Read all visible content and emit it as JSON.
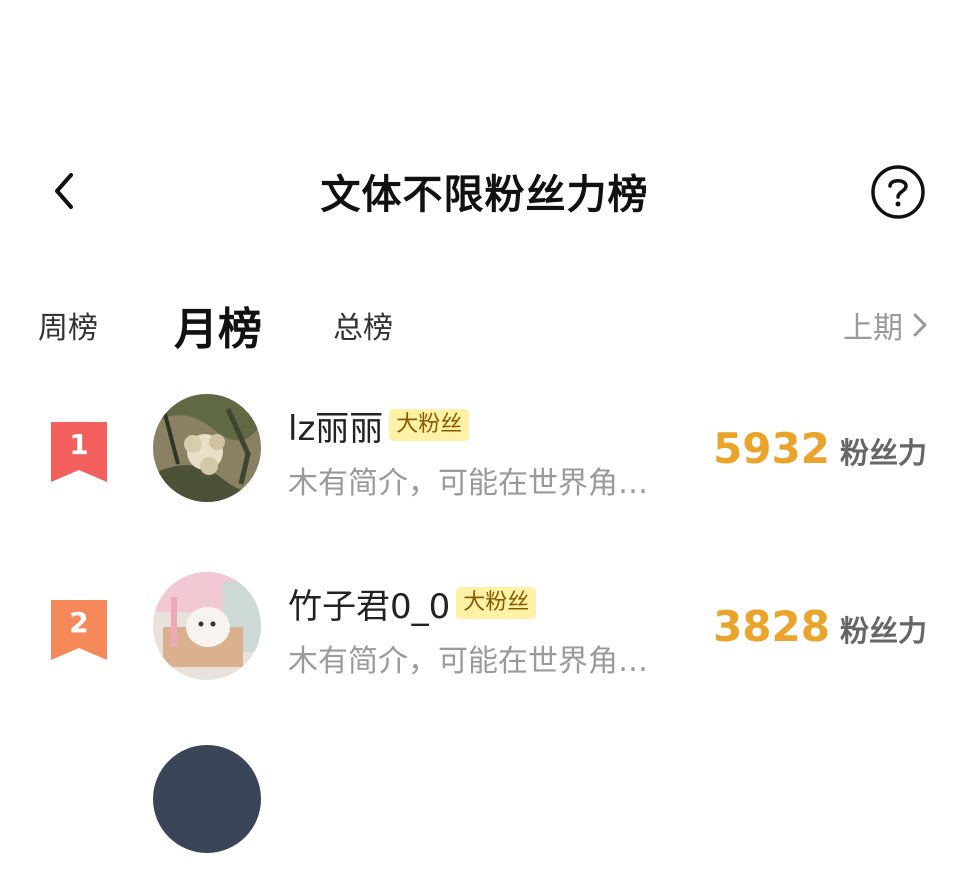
{
  "header": {
    "title": "文体不限粉丝力榜"
  },
  "tabs": [
    {
      "label": "周榜",
      "active": false
    },
    {
      "label": "月榜",
      "active": true
    },
    {
      "label": "总榜",
      "active": false
    }
  ],
  "prev_period": {
    "label": "上期"
  },
  "rows": [
    {
      "rank": "1",
      "username": "lz丽丽",
      "badge": "大粉丝",
      "bio": "木有简介，可能在世界角…",
      "score": "5932",
      "score_unit": "粉丝力"
    },
    {
      "rank": "2",
      "username": "竹子君0_0",
      "badge": "大粉丝",
      "bio": "木有简介，可能在世界角…",
      "score": "3828",
      "score_unit": "粉丝力"
    }
  ],
  "icons": {
    "back": "chevron-left-icon",
    "help": "question-circle-icon",
    "prev": "chevron-right-icon"
  },
  "colors": {
    "rank1": "#f25f5c",
    "rank2": "#f6895a",
    "score": "#eaa32b",
    "badge_bg": "#fff2a6"
  }
}
